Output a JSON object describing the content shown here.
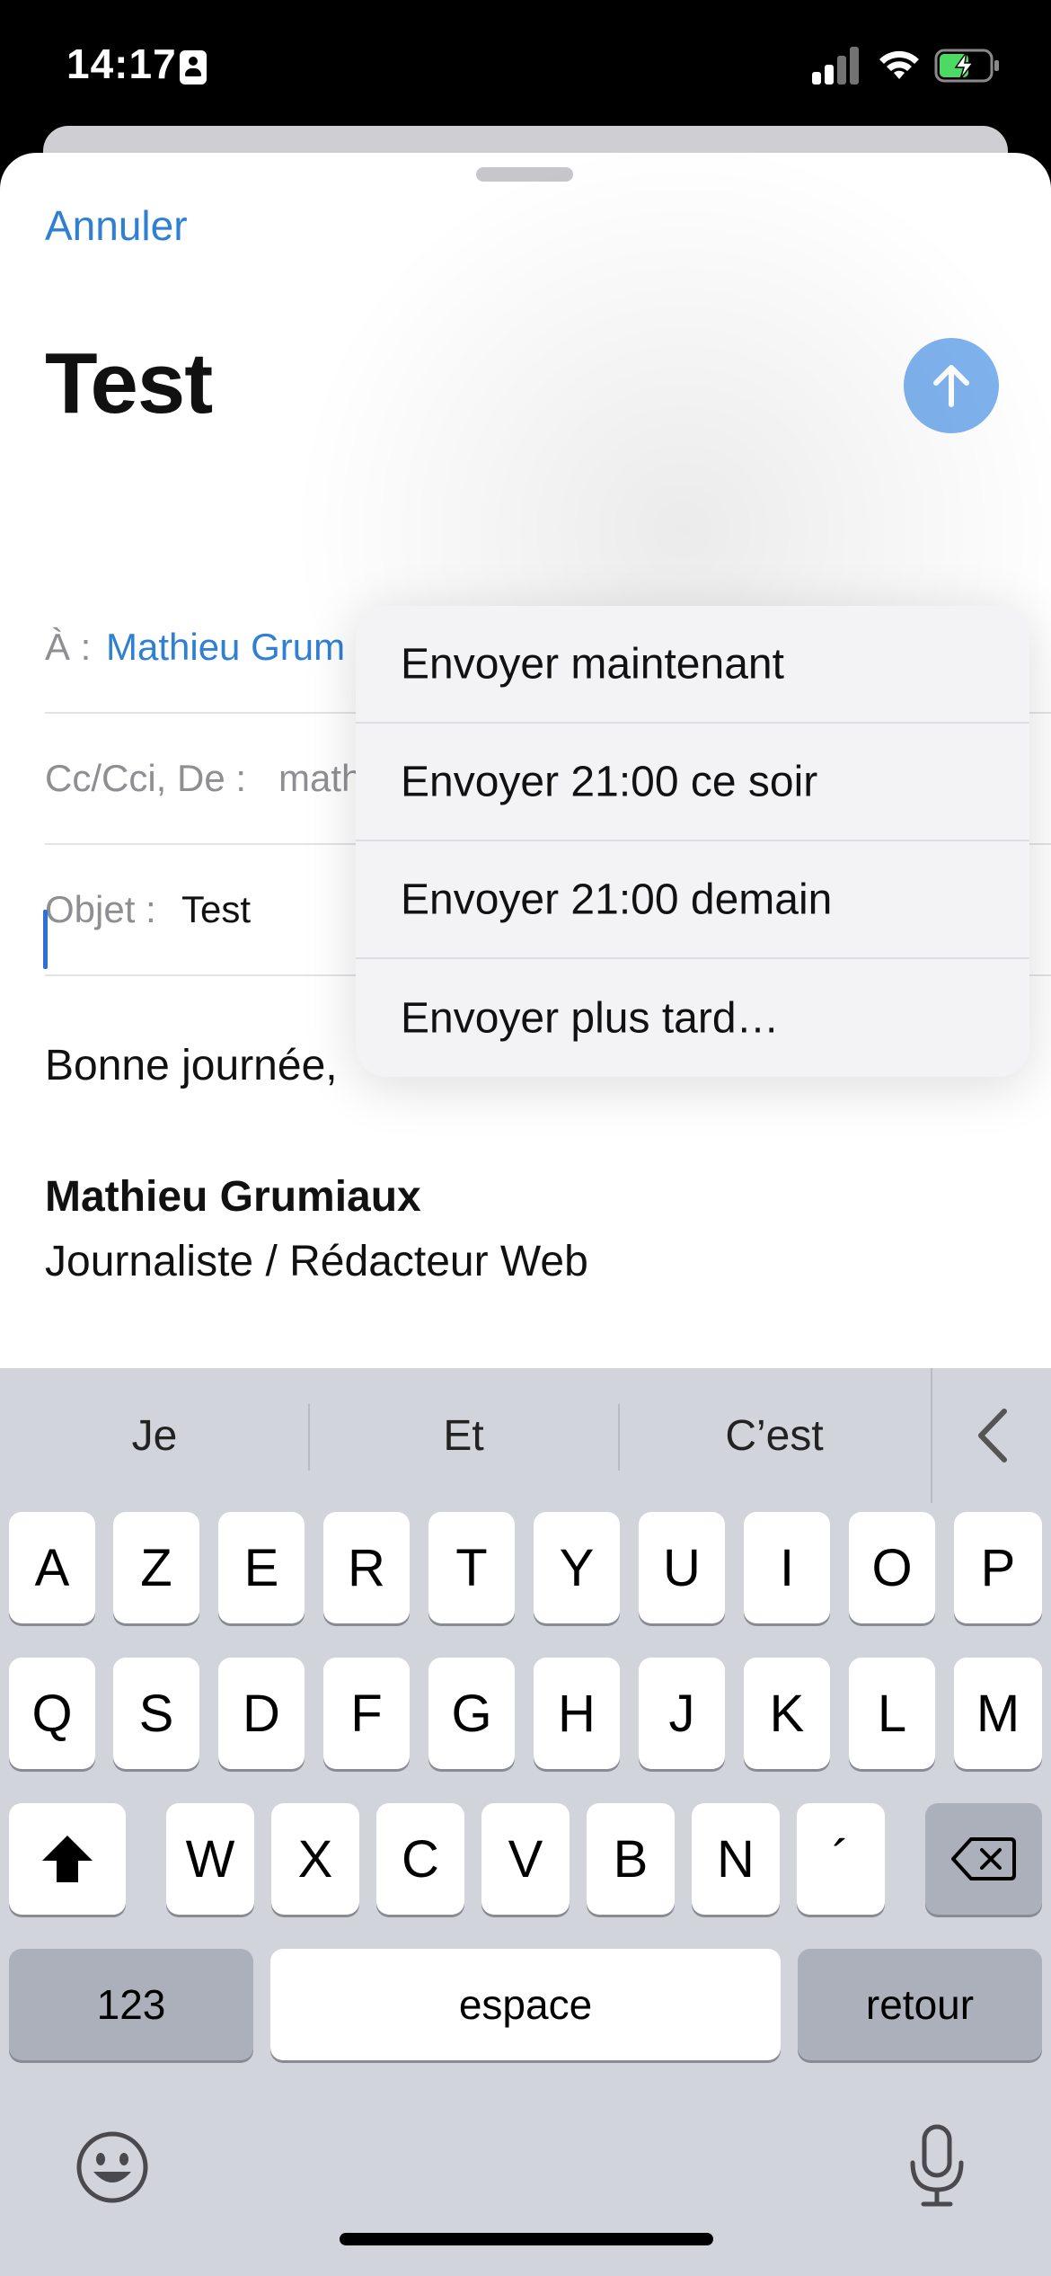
{
  "status_bar": {
    "time": "14:17",
    "icons": [
      "contact-badge-icon",
      "signal-icon",
      "wifi-icon",
      "battery-charging-icon"
    ]
  },
  "compose": {
    "cancel_label": "Annuler",
    "title": "Test",
    "send_icon": "arrow-up-icon",
    "fields": {
      "to_label": "À :",
      "to_value": "Mathieu Grum",
      "cc_label": "Cc/Cci, De :",
      "cc_value": "math",
      "subject_label": "Objet :",
      "subject_value": "Test"
    },
    "body": {
      "greeting": "Bonne journée,",
      "signature_name": "Mathieu Grumiaux",
      "signature_role": "Journaliste / Rédacteur Web"
    }
  },
  "send_menu": {
    "items": [
      {
        "label": "Envoyer maintenant"
      },
      {
        "label": "Envoyer 21:00 ce soir"
      },
      {
        "label": "Envoyer 21:00 demain"
      },
      {
        "label": "Envoyer plus tard…"
      }
    ]
  },
  "keyboard": {
    "suggestions": [
      "Je",
      "Et",
      "C’est"
    ],
    "row1": [
      "A",
      "Z",
      "E",
      "R",
      "T",
      "Y",
      "U",
      "I",
      "O",
      "P"
    ],
    "row2": [
      "Q",
      "S",
      "D",
      "F",
      "G",
      "H",
      "J",
      "K",
      "L",
      "M"
    ],
    "row3": [
      "W",
      "X",
      "C",
      "V",
      "B",
      "N",
      "´"
    ],
    "numbers_label": "123",
    "space_label": "espace",
    "return_label": "retour",
    "icons": [
      "shift-icon",
      "delete-icon",
      "emoji-icon",
      "microphone-icon",
      "chevron-left-icon"
    ]
  },
  "colors": {
    "accent": "#2f7fd3",
    "send_button": "#7fb3ee",
    "keyboard_bg": "#d1d4db"
  }
}
